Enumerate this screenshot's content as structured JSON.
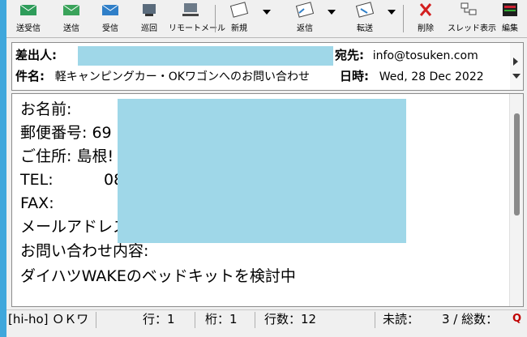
{
  "toolbar": {
    "send_receive": "送受信",
    "send": "送信",
    "receive": "受信",
    "patrol": "巡回",
    "remote_mail": "リモートメール",
    "new": "新規",
    "reply": "返信",
    "forward": "転送",
    "delete": "削除",
    "thread_view": "スレッド表示",
    "edit": "編集"
  },
  "header": {
    "from_label": "差出人:",
    "to_label": "宛先:",
    "to_value": "info@tosuken.com",
    "subject_label": "件名:",
    "subject_value": "軽キャンピングカー・OKワゴンへのお問い合わせ",
    "date_label": "日時:",
    "date_value": "Wed, 28 Dec 2022"
  },
  "body_lines": {
    "l1": "お名前:",
    "l2": "郵便番号: 69",
    "l3": "ご住所: 島根!",
    "l4a": "TEL:",
    "l4b": "08",
    "l5": "FAX:",
    "l6": "メールアドレス:",
    "l7": "お問い合わせ内容:",
    "l8": "ダイハツWAKEのベッドキットを検討中"
  },
  "status": {
    "folder": "[hi-ho] ＯＫワ",
    "row": "行：1",
    "col": "桁：1",
    "lines": "行数：12",
    "unread": "未読：",
    "count": "3 / 総数："
  },
  "colors": {
    "redaction": "#9fd7e8",
    "desktop": "#3fa7dc",
    "delete_icon": "#d32020"
  }
}
